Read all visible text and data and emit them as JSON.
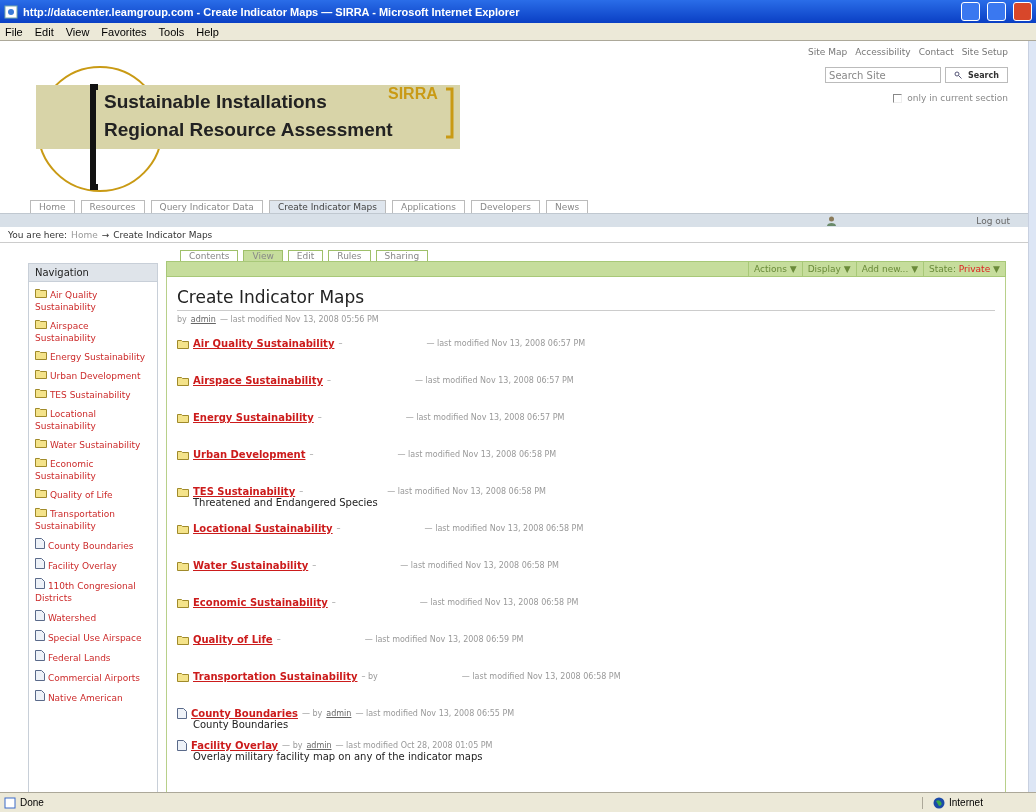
{
  "window": {
    "title": "http://datacenter.leamgroup.com - Create Indicator Maps — SIRRA - Microsoft Internet Explorer"
  },
  "menu": [
    "File",
    "Edit",
    "View",
    "Favorites",
    "Tools",
    "Help"
  ],
  "site_actions": [
    "Site Map",
    "Accessibility",
    "Contact",
    "Site Setup"
  ],
  "search": {
    "placeholder": "Search Site",
    "button": "Search"
  },
  "search_option": {
    "label": "only in current section",
    "checked": false
  },
  "logo": {
    "acronym": "SIRRA",
    "line1": "Sustainable Installations",
    "line2": "Regional Resource Assessment"
  },
  "portal_tabs": [
    {
      "label": "Home",
      "selected": false
    },
    {
      "label": "Resources",
      "selected": false
    },
    {
      "label": "Query Indicator Data",
      "selected": false
    },
    {
      "label": "Create Indicator Maps",
      "selected": true
    },
    {
      "label": "Applications",
      "selected": false
    },
    {
      "label": "Developers",
      "selected": false
    },
    {
      "label": "News",
      "selected": false
    }
  ],
  "personal_bar": {
    "logout": "Log out"
  },
  "breadcrumb": {
    "prefix": "You are here:",
    "home": "Home",
    "separator": "→",
    "current": "Create Indicator Maps"
  },
  "navigation": {
    "title": "Navigation",
    "items": [
      {
        "label": "Air Quality Sustainability",
        "kind": "folder"
      },
      {
        "label": "Airspace Sustainability",
        "kind": "folder"
      },
      {
        "label": "Energy Sustainability",
        "kind": "folder"
      },
      {
        "label": "Urban Development",
        "kind": "folder"
      },
      {
        "label": "TES Sustainability",
        "kind": "folder"
      },
      {
        "label": "Locational Sustainability",
        "kind": "folder"
      },
      {
        "label": "Water Sustainability",
        "kind": "folder"
      },
      {
        "label": "Economic Sustainability",
        "kind": "folder"
      },
      {
        "label": "Quality of Life",
        "kind": "folder"
      },
      {
        "label": "Transportation Sustainability",
        "kind": "folder"
      },
      {
        "label": "County Boundaries",
        "kind": "document"
      },
      {
        "label": "Facility Overlay",
        "kind": "document"
      },
      {
        "label": "110th Congresional Districts",
        "kind": "document"
      },
      {
        "label": "Watershed",
        "kind": "document"
      },
      {
        "label": "Special Use Airspace",
        "kind": "document"
      },
      {
        "label": "Federal Lands",
        "kind": "document"
      },
      {
        "label": "Commercial Airports",
        "kind": "document"
      },
      {
        "label": "Native American",
        "kind": "document"
      }
    ]
  },
  "content_tabs": [
    {
      "label": "Contents",
      "selected": false
    },
    {
      "label": "View",
      "selected": true
    },
    {
      "label": "Edit",
      "selected": false
    },
    {
      "label": "Rules",
      "selected": false
    },
    {
      "label": "Sharing",
      "selected": false
    }
  ],
  "content_actions": [
    "Actions ▼",
    "Display ▼",
    "Add new... ▼"
  ],
  "state": {
    "label": "State:",
    "value": "Private",
    "arrow": "▼"
  },
  "page": {
    "title": "Create Indicator Maps",
    "by": "by",
    "author": "admin",
    "modified": "— last modified Nov 13, 2008 05:56 PM"
  },
  "entries": [
    {
      "kind": "folder",
      "title": "Air Quality Sustainability",
      "sep": "–",
      "modified": "— last modified Nov 13, 2008 06:57 PM"
    },
    {
      "kind": "folder",
      "title": "Airspace Sustainability",
      "sep": "–",
      "modified": "— last modified Nov 13, 2008 06:57 PM"
    },
    {
      "kind": "folder",
      "title": "Energy Sustainability",
      "sep": "–",
      "modified": "— last modified Nov 13, 2008 06:57 PM"
    },
    {
      "kind": "folder",
      "title": "Urban Development",
      "sep": "–",
      "modified": "— last modified Nov 13, 2008 06:58 PM"
    },
    {
      "kind": "folder",
      "title": "TES Sustainability",
      "sep": "–",
      "modified": "— last modified Nov 13, 2008 06:58 PM",
      "description": "Threatened and Endangered Species"
    },
    {
      "kind": "folder",
      "title": "Locational Sustainability",
      "sep": "–",
      "modified": "— last modified Nov 13, 2008 06:58 PM"
    },
    {
      "kind": "folder",
      "title": "Water Sustainability",
      "sep": "–",
      "modified": "— last modified Nov 13, 2008 06:58 PM"
    },
    {
      "kind": "folder",
      "title": "Economic Sustainability",
      "sep": "–",
      "modified": "— last modified Nov 13, 2008 06:58 PM"
    },
    {
      "kind": "folder",
      "title": "Quality of Life",
      "sep": "–",
      "modified": "— last modified Nov 13, 2008 06:59 PM"
    },
    {
      "kind": "folder",
      "title": "Transportation Sustainability",
      "sep": "– by",
      "modified": "— last modified Nov 13, 2008 06:58 PM"
    },
    {
      "kind": "document",
      "title": "County Boundaries",
      "sep": "— by",
      "author": "admin",
      "modified": "— last modified Nov 13, 2008 06:55 PM",
      "description": "County Boundaries"
    },
    {
      "kind": "document",
      "title": "Facility Overlay",
      "sep": "— by",
      "author": "admin",
      "modified": "— last modified Oct 28, 2008 01:05 PM",
      "description": "Overlay military facility map on any of the indicator maps"
    }
  ],
  "status_bar": {
    "text": "Done",
    "zone": "Internet"
  }
}
